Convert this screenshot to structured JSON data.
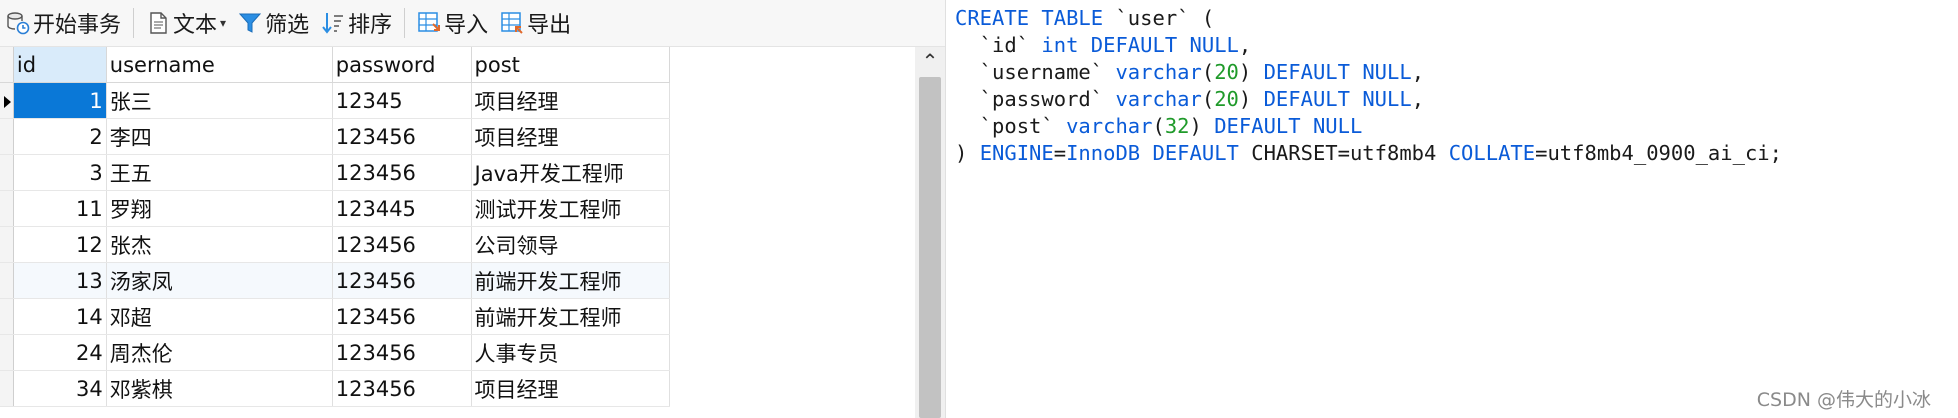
{
  "toolbar": {
    "begin_tx": "开始事务",
    "text": "文本",
    "filter": "筛选",
    "sort": "排序",
    "import": "导入",
    "export": "导出"
  },
  "grid": {
    "columns": [
      "id",
      "username",
      "password",
      "post"
    ],
    "rows": [
      {
        "id": "1",
        "username": "张三",
        "password": "12345",
        "post": "项目经理"
      },
      {
        "id": "2",
        "username": "李四",
        "password": "123456",
        "post": "项目经理"
      },
      {
        "id": "3",
        "username": "王五",
        "password": "123456",
        "post": "Java开发工程师"
      },
      {
        "id": "11",
        "username": "罗翔",
        "password": "123445",
        "post": "测试开发工程师"
      },
      {
        "id": "12",
        "username": "张杰",
        "password": "123456",
        "post": "公司领导"
      },
      {
        "id": "13",
        "username": "汤家凤",
        "password": "123456",
        "post": "前端开发工程师"
      },
      {
        "id": "14",
        "username": "邓超",
        "password": "123456",
        "post": "前端开发工程师"
      },
      {
        "id": "24",
        "username": "周杰伦",
        "password": "123456",
        "post": "人事专员"
      },
      {
        "id": "34",
        "username": "邓紫棋",
        "password": "123456",
        "post": "项目经理"
      }
    ],
    "selected_row": 0
  },
  "sql": {
    "line1": "CREATE TABLE `user` (",
    "line2": "  `id` int DEFAULT NULL,",
    "line3": "  `username` varchar(20) DEFAULT NULL,",
    "line4": "  `password` varchar(20) DEFAULT NULL,",
    "line5": "  `post` varchar(32) DEFAULT NULL",
    "line6": ") ENGINE=InnoDB DEFAULT CHARSET=utf8mb4 COLLATE=utf8mb4_0900_ai_ci;"
  },
  "watermark": "CSDN @伟大的小冰",
  "colors": {
    "selection": "#0a78d7",
    "keyword": "#0a5bd8",
    "number": "#1f9a2a"
  }
}
